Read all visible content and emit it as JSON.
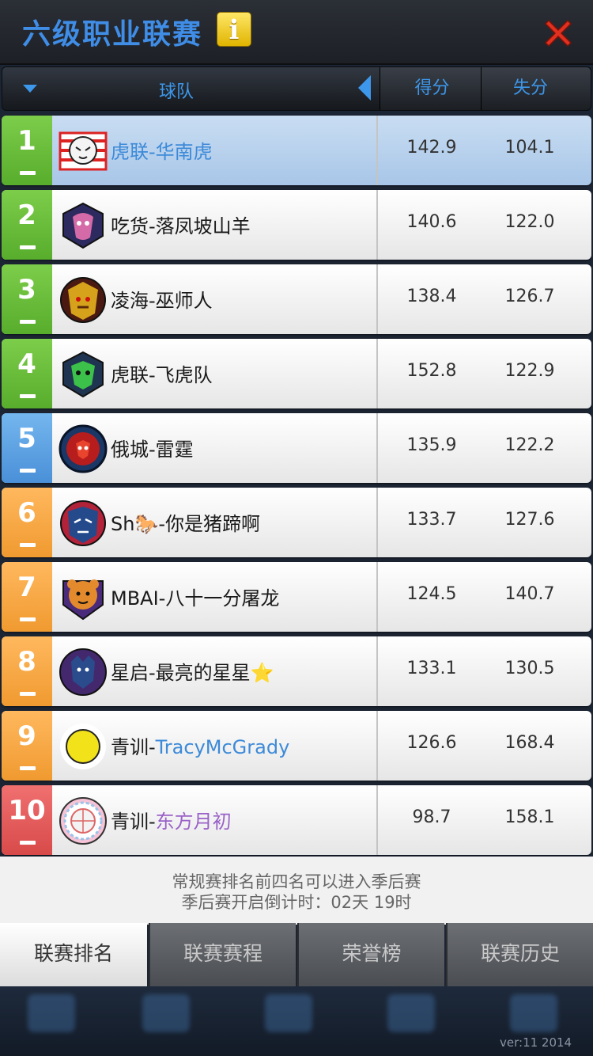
{
  "header": {
    "title": "六级职业联赛",
    "info_icon": "i"
  },
  "columns": {
    "team": "球队",
    "score": "得分",
    "loss": "失分"
  },
  "rows": [
    {
      "rank": "1",
      "name": "虎联-华南虎",
      "prefix": "",
      "suffix": "",
      "score": "142.9",
      "loss": "104.1",
      "color": "green",
      "selected": true,
      "logo": "tiger-logo"
    },
    {
      "rank": "2",
      "name": "吃货-落凤坡山羊",
      "prefix": "",
      "suffix": "",
      "score": "140.6",
      "loss": "122.0",
      "color": "green",
      "selected": false,
      "logo": "goat-logo"
    },
    {
      "rank": "3",
      "name": "凌海-巫师人",
      "prefix": "",
      "suffix": "",
      "score": "138.4",
      "loss": "126.7",
      "color": "green",
      "selected": false,
      "logo": "wizard-logo"
    },
    {
      "rank": "4",
      "name": "虎联-飞虎队",
      "prefix": "",
      "suffix": "",
      "score": "152.8",
      "loss": "122.9",
      "color": "green",
      "selected": false,
      "logo": "flying-tiger-logo"
    },
    {
      "rank": "5",
      "name": "俄城-雷霆",
      "prefix": "",
      "suffix": "",
      "score": "135.9",
      "loss": "122.2",
      "color": "blue",
      "selected": false,
      "logo": "thunder-logo"
    },
    {
      "rank": "6",
      "name": "Sh🐎-你是猪蹄啊",
      "prefix": "",
      "suffix": "",
      "score": "133.7",
      "loss": "127.6",
      "color": "orange",
      "selected": false,
      "logo": "dragon-logo"
    },
    {
      "rank": "7",
      "name": "MBAI-八十一分屠龙",
      "prefix": "",
      "suffix": "",
      "score": "124.5",
      "loss": "140.7",
      "color": "orange",
      "selected": false,
      "logo": "bear-logo"
    },
    {
      "rank": "8",
      "name": "星启-最亮的星星⭐",
      "prefix": "",
      "suffix": "",
      "score": "133.1",
      "loss": "130.5",
      "color": "orange",
      "selected": false,
      "logo": "wolf-logo"
    },
    {
      "rank": "9",
      "name": "TracyMcGrady",
      "prefix": "青训-",
      "suffix": "",
      "score": "126.6",
      "loss": "168.4",
      "color": "orange",
      "selected": false,
      "logo": "yellow-ball-logo"
    },
    {
      "rank": "10",
      "name": "东方月初",
      "prefix": "青训-",
      "suffix": "",
      "score": "98.7",
      "loss": "158.1",
      "color": "red",
      "selected": false,
      "logo": "basketball-logo"
    }
  ],
  "note": {
    "line1": "常规赛排名前四名可以进入季后赛",
    "line2": "季后赛开启倒计时：02天 19时"
  },
  "tabs": [
    {
      "label": "联赛排名",
      "active": true
    },
    {
      "label": "联赛赛程",
      "active": false
    },
    {
      "label": "荣誉榜",
      "active": false
    },
    {
      "label": "联赛历史",
      "active": false
    }
  ],
  "version": "ver:11  2014",
  "colors": {
    "title": "#3f8de6",
    "green": "#6bbf3b",
    "blue": "#5aa2e3",
    "orange": "#f7a945",
    "red": "#e25a5a",
    "selected_row": "#b8d2ee"
  }
}
